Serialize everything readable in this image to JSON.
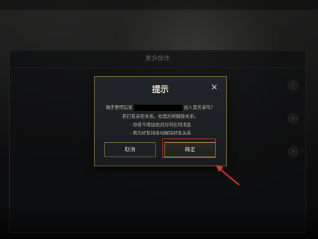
{
  "dialog": {
    "title": "提示",
    "line1_prefix": "确定要把玩家",
    "line1_suffix": "加入黑名单吗？",
    "line2": "若已有亲密关系，拉黑后将解除关系。",
    "line3": "- 你将不再接收对方的任何消息",
    "line4": "- 若为好友将自动解除好友关系",
    "cancel_label": "取消",
    "confirm_label": "确定"
  },
  "background_panel": {
    "title": "更多操作"
  },
  "colors": {
    "accent_gold": "#a88d52",
    "highlight_red": "#d8382d"
  }
}
